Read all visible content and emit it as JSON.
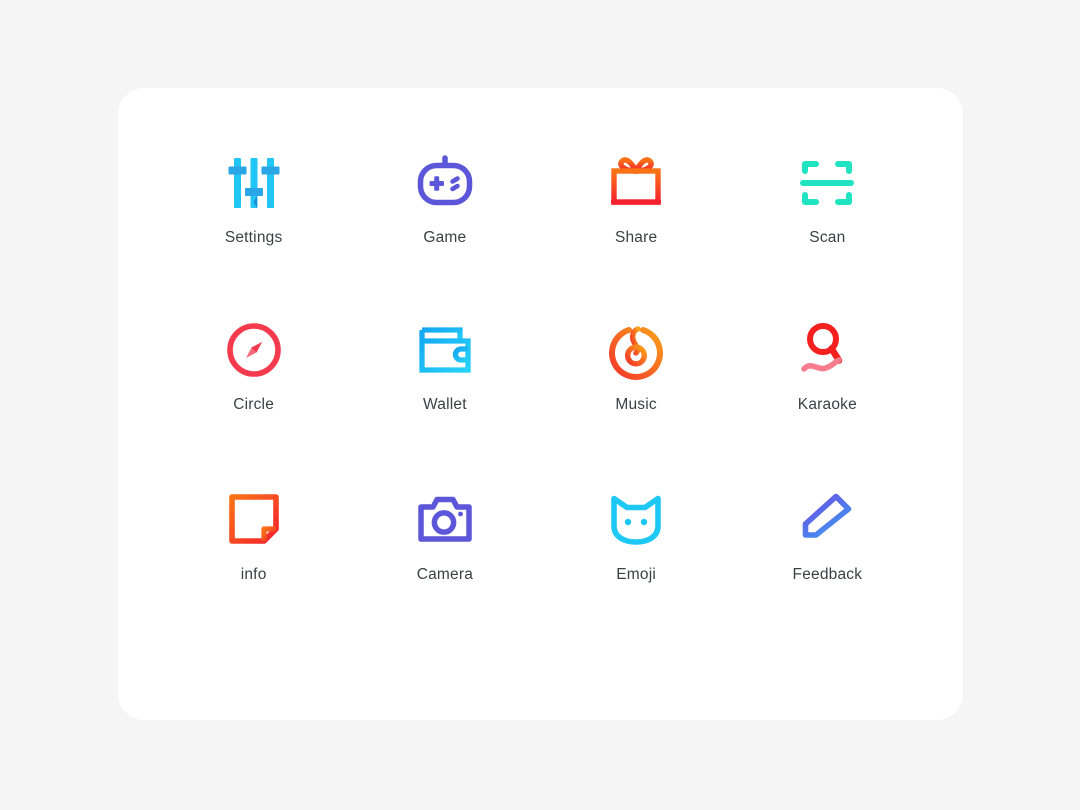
{
  "page": {
    "background_color": "#f5f5f6",
    "card_background": "#ffffff",
    "label_color": "#3c3f44"
  },
  "grid": {
    "columns": 4,
    "rows": 3,
    "items": [
      {
        "label": "Settings",
        "icon": "sliders-icon",
        "colors": {
          "primary": "#22c6f5",
          "secondary": "#2aa6e6"
        }
      },
      {
        "label": "Game",
        "icon": "game-controller-icon",
        "colors": {
          "primary": "#5b57d8",
          "secondary": "#5b57d8"
        }
      },
      {
        "label": "Share",
        "icon": "gift-box-icon",
        "colors": {
          "primary": "#f97316",
          "secondary": "#f4212e"
        }
      },
      {
        "label": "Scan",
        "icon": "scan-frame-icon",
        "colors": {
          "primary": "#20e3c1",
          "secondary": "#15d9c4"
        }
      },
      {
        "label": "Circle",
        "icon": "compass-icon",
        "colors": {
          "primary": "#f43b4e",
          "secondary": "#fa6a7a"
        }
      },
      {
        "label": "Wallet",
        "icon": "wallet-icon",
        "colors": {
          "primary": "#16b6f2",
          "secondary": "#22c6f5"
        }
      },
      {
        "label": "Music",
        "icon": "music-note-ring-icon",
        "colors": {
          "primary": "#f4352a",
          "secondary": "#fba01b"
        }
      },
      {
        "label": "Karaoke",
        "icon": "microphone-icon",
        "colors": {
          "primary": "#f42020",
          "secondary": "#f77d8e"
        }
      },
      {
        "label": "info",
        "icon": "note-document-icon",
        "colors": {
          "primary": "#f97316",
          "secondary": "#f4212e"
        }
      },
      {
        "label": "Camera",
        "icon": "camera-icon",
        "colors": {
          "primary": "#5b57d8",
          "secondary": "#5b57d8"
        }
      },
      {
        "label": "Emoji",
        "icon": "cat-face-icon",
        "colors": {
          "primary": "#1ec8f5",
          "secondary": "#1ec8f5"
        }
      },
      {
        "label": "Feedback",
        "icon": "pencil-edit-icon",
        "colors": {
          "primary": "#6d4de0",
          "secondary": "#3b9ef5"
        }
      }
    ]
  }
}
